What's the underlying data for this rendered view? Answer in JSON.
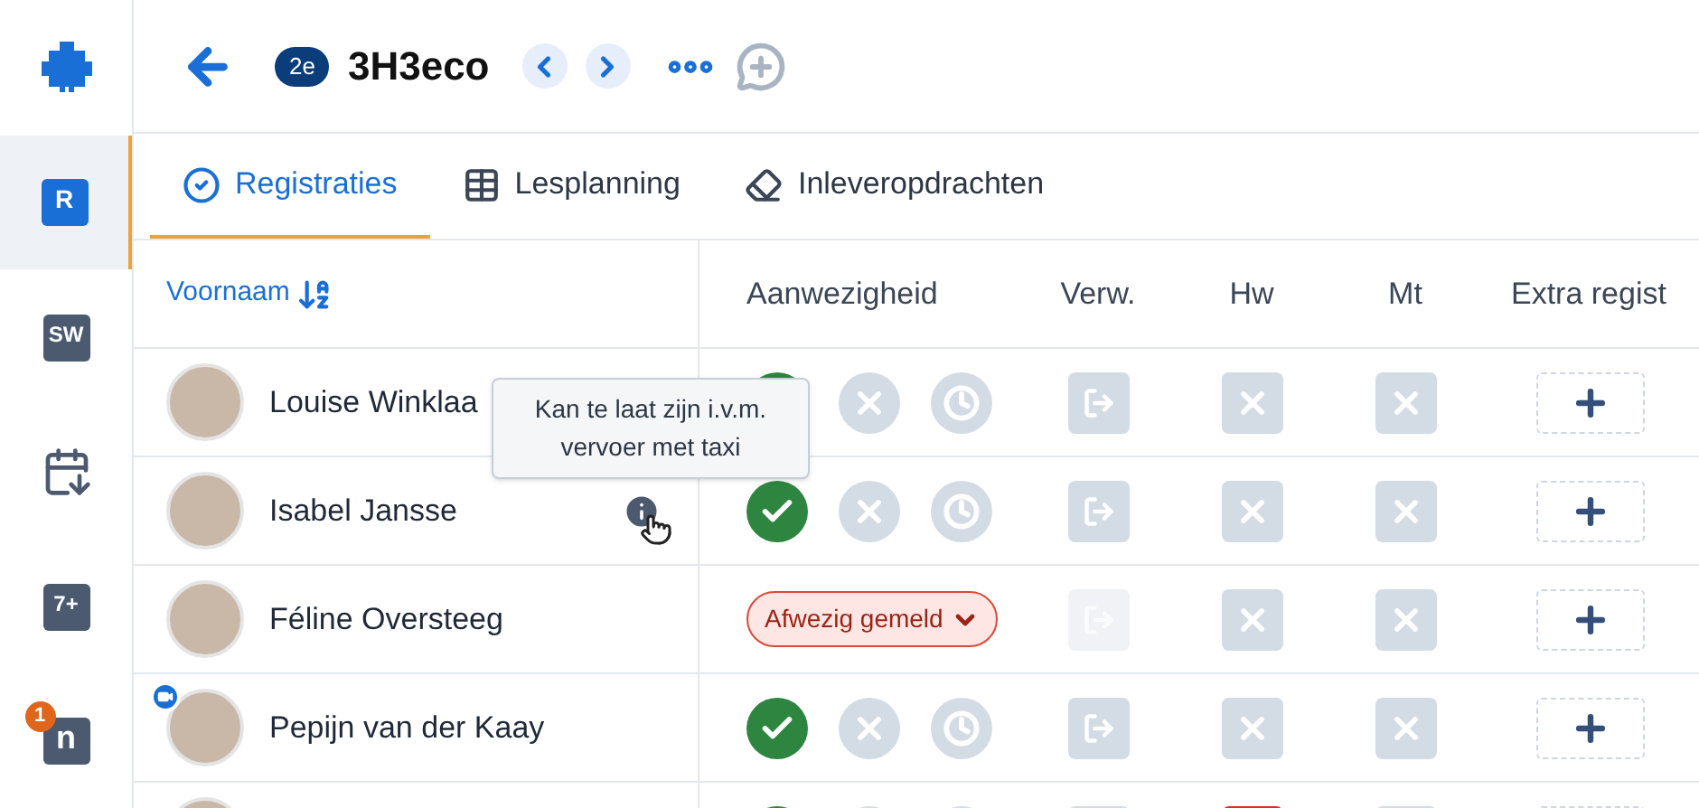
{
  "sidebar": {
    "items": [
      {
        "kind": "logo",
        "selected": false
      },
      {
        "kind": "letter",
        "label": "R",
        "selected": true
      },
      {
        "kind": "letter",
        "label": "SW",
        "selected": false
      },
      {
        "kind": "calendar",
        "selected": false
      },
      {
        "kind": "letter",
        "label": "7+",
        "selected": false
      },
      {
        "kind": "letter",
        "label": "n",
        "badge": "1",
        "selected": false
      }
    ]
  },
  "header": {
    "grade": "2e",
    "title": "3H3eco"
  },
  "tabs": [
    {
      "label": "Registraties",
      "selected": true
    },
    {
      "label": "Lesplanning",
      "selected": false
    },
    {
      "label": "Inleveropdrachten",
      "selected": false
    }
  ],
  "table": {
    "columns": [
      "Voornaam",
      "Aanwezigheid",
      "Verw.",
      "Hw",
      "Mt",
      "Extra regist"
    ],
    "rows": [
      {
        "name": "Louise Winklaa",
        "kind": "present",
        "verw_disabled": false,
        "hw_marked": false,
        "video": false,
        "info": false
      },
      {
        "name": "Isabel Jansse",
        "kind": "present",
        "verw_disabled": false,
        "hw_marked": false,
        "video": false,
        "info": true
      },
      {
        "name": "Féline Oversteeg",
        "kind": "reported",
        "status": "Afwezig gemeld",
        "verw_disabled": true,
        "hw_marked": false,
        "video": false,
        "info": false
      },
      {
        "name": "Pepijn van der Kaay",
        "kind": "present",
        "verw_disabled": false,
        "hw_marked": false,
        "video": true,
        "info": false
      },
      {
        "kind": "present",
        "verw_disabled": false,
        "hw_marked": true,
        "video": false,
        "info": false
      }
    ]
  },
  "tooltip": "Kan te laat zijn i.v.m. vervoer met taxi"
}
